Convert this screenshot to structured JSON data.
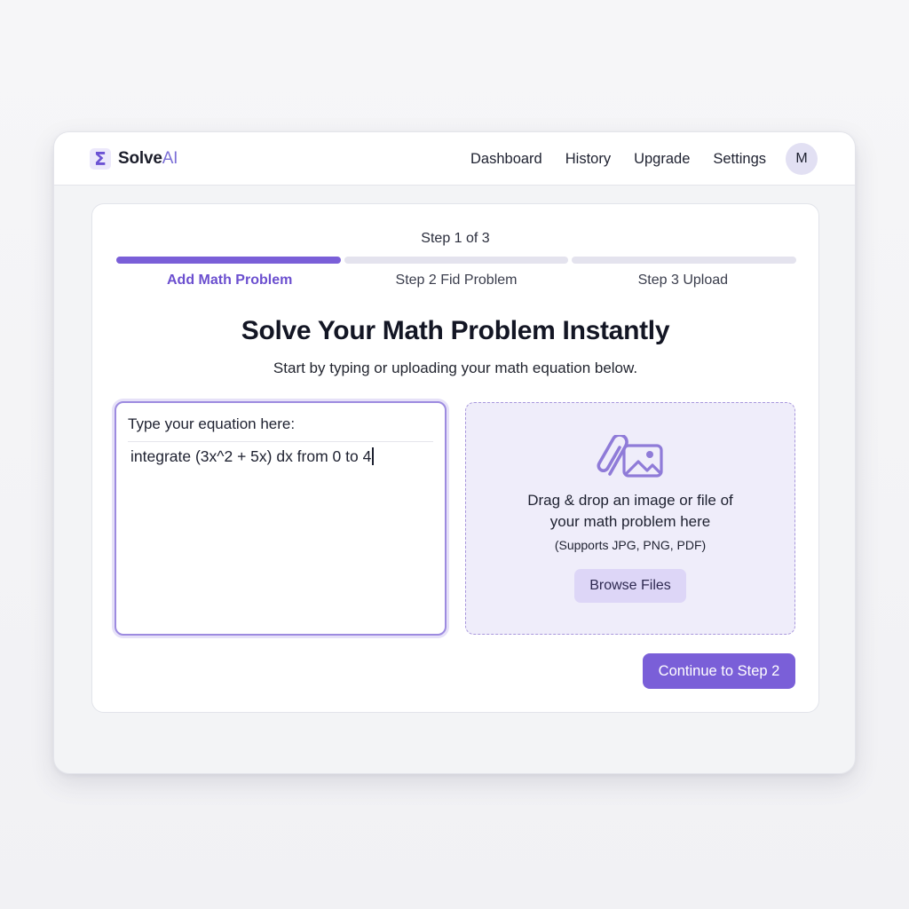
{
  "brand": {
    "icon": "sigma-icon",
    "icon_glyph": "Σ",
    "name_part1": "Solve",
    "name_part2": "AI"
  },
  "nav": {
    "items": [
      {
        "label": "Dashboard"
      },
      {
        "label": "History"
      },
      {
        "label": "Upgrade"
      },
      {
        "label": "Settings"
      }
    ],
    "avatar_initial": "M"
  },
  "stepper": {
    "count_label": "Step 1 of 3",
    "progress": {
      "current_step": 1,
      "total_steps": 3
    },
    "steps": [
      {
        "label": "Add Math Problem",
        "active": true
      },
      {
        "label": "Step 2 Fid Problem",
        "active": false
      },
      {
        "label": "Step 3 Upload",
        "active": false
      }
    ]
  },
  "main": {
    "title": "Solve Your Math Problem Instantly",
    "subtitle": "Start by typing or uploading your math equation below."
  },
  "equation": {
    "label": "Type your equation here:",
    "value": "integrate (3x^2 + 5x) dx from 0 to 4"
  },
  "upload": {
    "icon": "paperclip-image-icon",
    "text_line1": "Drag & drop an image or file of",
    "text_line2": "your math problem here",
    "supports": "(Supports JPG, PNG, PDF)",
    "browse_label": "Browse Files"
  },
  "actions": {
    "continue_label": "Continue to Step 2"
  },
  "colors": {
    "accent": "#7a5fd8",
    "accent_text": "#6b4fcf",
    "dropzone_bg": "#efedfa",
    "progress_track": "#e4e3ee"
  }
}
